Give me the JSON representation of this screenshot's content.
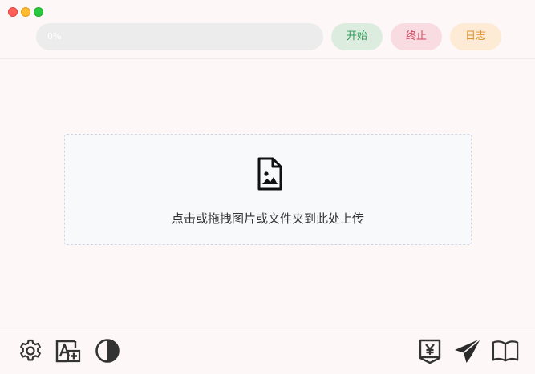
{
  "window": {
    "controls": [
      "close",
      "minimize",
      "maximize"
    ]
  },
  "progress": {
    "value": 0,
    "label": "0%"
  },
  "buttons": {
    "start": "开始",
    "stop": "终止",
    "log": "日志"
  },
  "upload": {
    "hint": "点击或拖拽图片或文件夹到此处上传",
    "icon": "image-file-icon"
  },
  "toolbar": {
    "left": [
      "gear-icon",
      "font-size-icon",
      "contrast-icon"
    ],
    "right": [
      "yuan-donate-icon",
      "send-icon",
      "book-icon"
    ]
  },
  "colors": {
    "background": "#fdf8f7",
    "start": "#2e9a58",
    "stop": "#d0455e",
    "log": "#e0922c",
    "progress_track": "#ececec"
  }
}
